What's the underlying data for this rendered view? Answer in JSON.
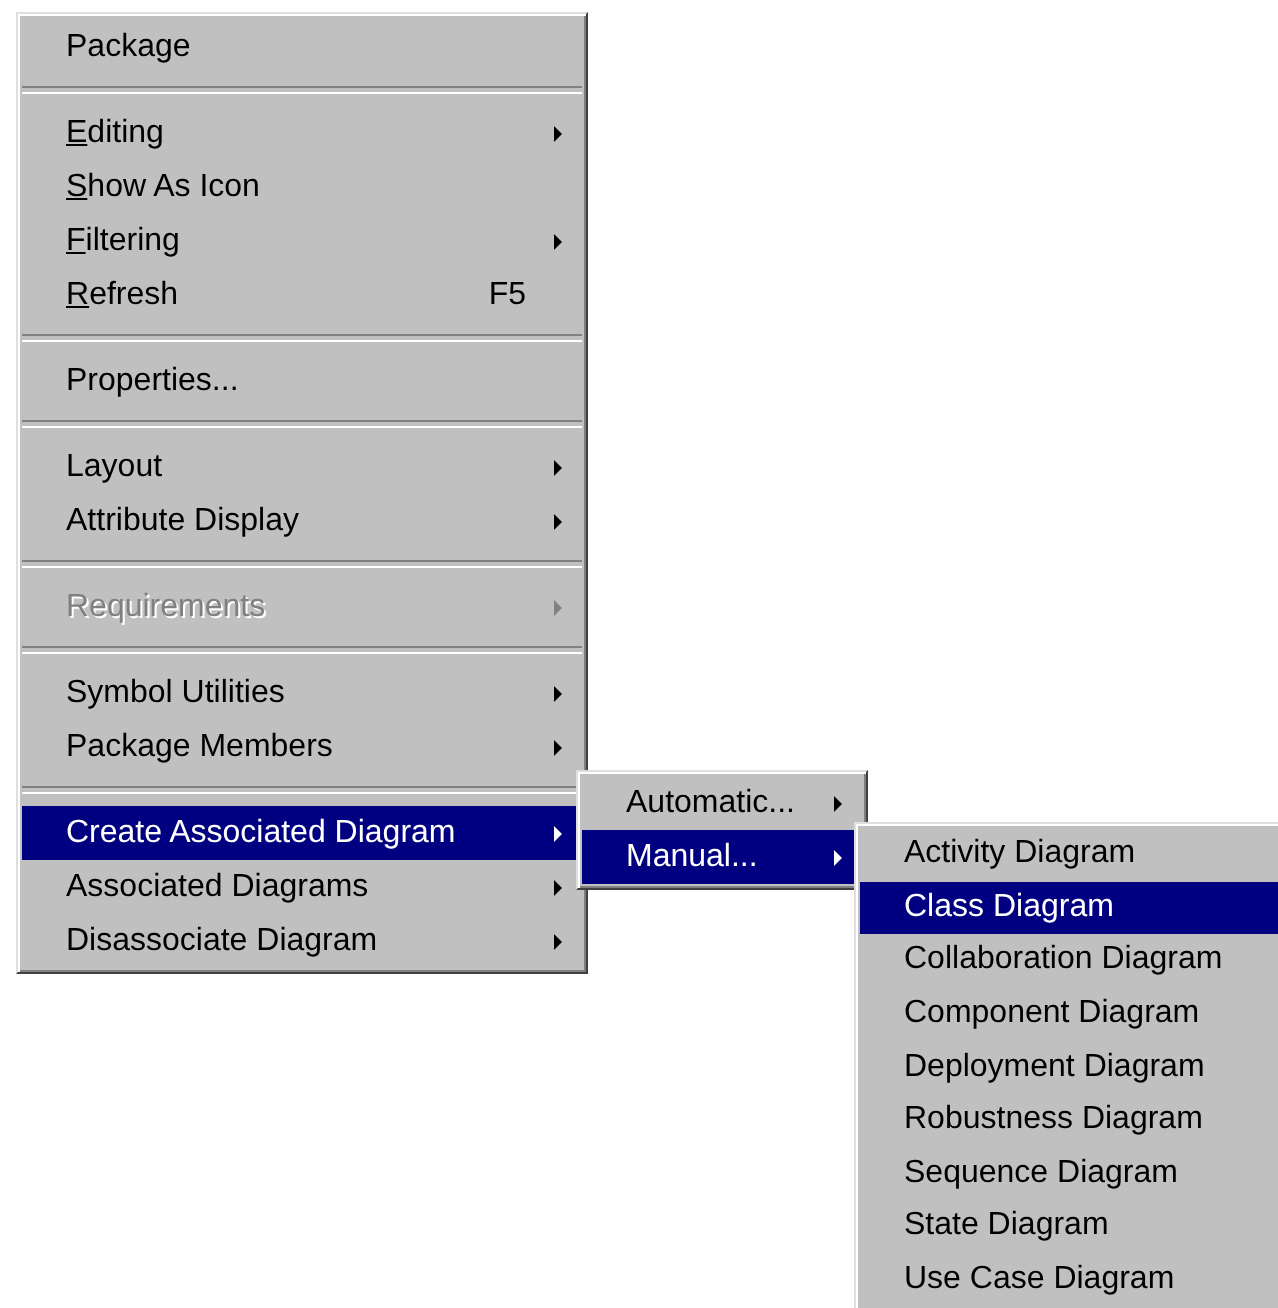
{
  "menu": {
    "sections": [
      [
        {
          "label": "Package",
          "submenu": false,
          "disabled": false,
          "selected": false,
          "underline_first": false
        }
      ],
      [
        {
          "label": "Editing",
          "submenu": true,
          "disabled": false,
          "selected": false,
          "underline_first": true
        },
        {
          "label": "Show As Icon",
          "submenu": false,
          "disabled": false,
          "selected": false,
          "underline_first": true
        },
        {
          "label": "Filtering",
          "submenu": true,
          "disabled": false,
          "selected": false,
          "underline_first": true
        },
        {
          "label": "Refresh",
          "shortcut": "F5",
          "submenu": false,
          "disabled": false,
          "selected": false,
          "underline_first": true
        }
      ],
      [
        {
          "label": "Properties...",
          "submenu": false,
          "disabled": false,
          "selected": false,
          "underline_first": false
        }
      ],
      [
        {
          "label": "Layout",
          "submenu": true,
          "disabled": false,
          "selected": false,
          "underline_first": false
        },
        {
          "label": "Attribute Display",
          "submenu": true,
          "disabled": false,
          "selected": false,
          "underline_first": false
        }
      ],
      [
        {
          "label": "Requirements",
          "submenu": true,
          "disabled": true,
          "selected": false,
          "underline_first": false
        }
      ],
      [
        {
          "label": "Symbol Utilities",
          "submenu": true,
          "disabled": false,
          "selected": false,
          "underline_first": false
        },
        {
          "label": "Package Members",
          "submenu": true,
          "disabled": false,
          "selected": false,
          "underline_first": false
        }
      ],
      [
        {
          "label": "Create Associated Diagram",
          "submenu": true,
          "disabled": false,
          "selected": true,
          "underline_first": false
        },
        {
          "label": "Associated Diagrams",
          "submenu": true,
          "disabled": false,
          "selected": false,
          "underline_first": false
        },
        {
          "label": "Disassociate Diagram",
          "submenu": true,
          "disabled": false,
          "selected": false,
          "underline_first": false
        }
      ]
    ]
  },
  "submenus": [
    {
      "items": [
        {
          "label": "Automatic...",
          "submenu": true,
          "disabled": false,
          "selected": false,
          "underline_first": false
        },
        {
          "label": "Manual...",
          "submenu": true,
          "disabled": false,
          "selected": true,
          "underline_first": false
        }
      ]
    },
    {
      "items": [
        {
          "label": "Activity Diagram",
          "submenu": false,
          "disabled": false,
          "selected": false,
          "underline_first": false
        },
        {
          "label": "Class Diagram",
          "submenu": false,
          "disabled": false,
          "selected": true,
          "underline_first": false
        },
        {
          "label": "Collaboration Diagram",
          "submenu": false,
          "disabled": false,
          "selected": false,
          "underline_first": false
        },
        {
          "label": "Component Diagram",
          "submenu": false,
          "disabled": false,
          "selected": false,
          "underline_first": false
        },
        {
          "label": "Deployment Diagram",
          "submenu": false,
          "disabled": false,
          "selected": false,
          "underline_first": false
        },
        {
          "label": "Robustness Diagram",
          "submenu": false,
          "disabled": false,
          "selected": false,
          "underline_first": false
        },
        {
          "label": "Sequence Diagram",
          "submenu": false,
          "disabled": false,
          "selected": false,
          "underline_first": false
        },
        {
          "label": "State Diagram",
          "submenu": false,
          "disabled": false,
          "selected": false,
          "underline_first": false
        },
        {
          "label": "Use Case Diagram",
          "submenu": false,
          "disabled": false,
          "selected": false,
          "underline_first": false
        }
      ]
    }
  ]
}
